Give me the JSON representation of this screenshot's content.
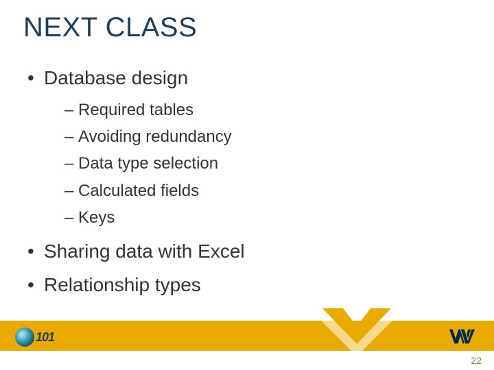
{
  "title": "NEXT CLASS",
  "bullets": [
    {
      "text": "Database design",
      "sub": [
        "Required tables",
        "Avoiding redundancy",
        "Data type selection",
        "Calculated fields",
        "Keys"
      ]
    },
    {
      "text": "Sharing data with Excel",
      "sub": []
    },
    {
      "text": "Relationship types",
      "sub": []
    }
  ],
  "footer": {
    "course_code": "101",
    "page_number": "22"
  },
  "colors": {
    "title": "#1f3d5c",
    "accent_gold": "#eaab00",
    "wv_blue": "#002855"
  }
}
